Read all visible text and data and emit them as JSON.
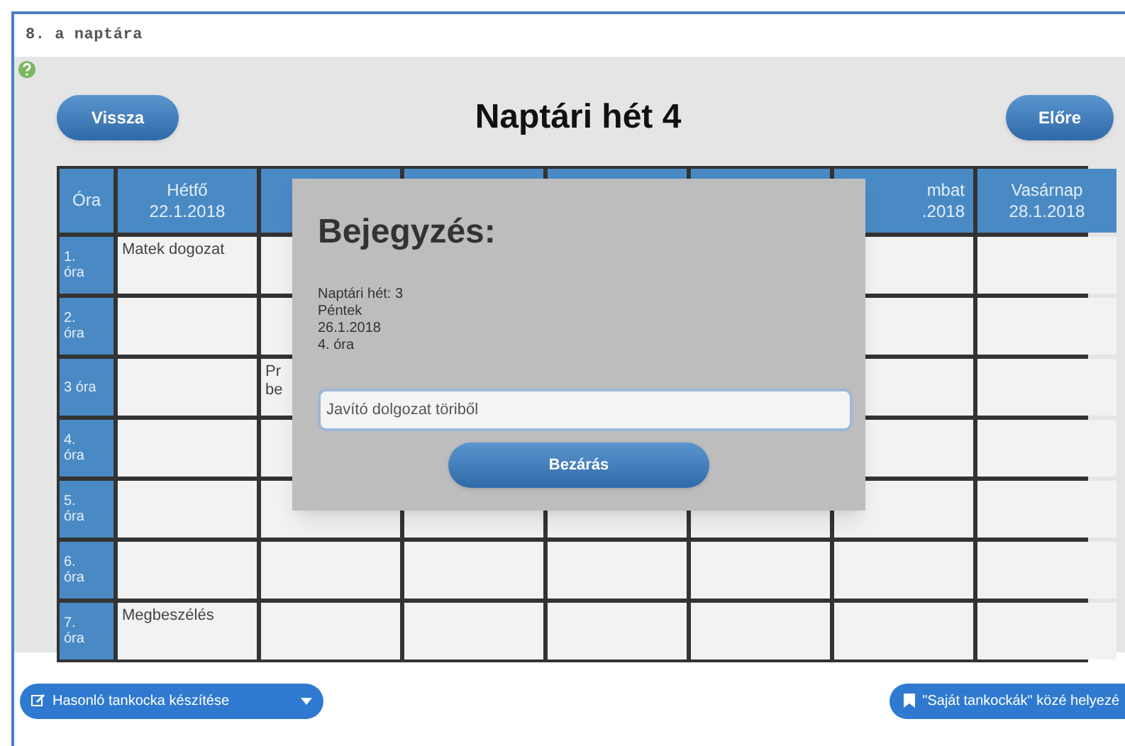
{
  "window": {
    "title": "8. a naptára"
  },
  "nav": {
    "back": "Vissza",
    "title": "Naptári hét 4",
    "forward": "Előre"
  },
  "table": {
    "corner": "Óra",
    "columns": [
      {
        "day": "Hétfő",
        "date": "22.1.2018"
      },
      {},
      {},
      {},
      {},
      {
        "day": "mbat",
        "date": ".2018"
      },
      {
        "day": "Vasárnap",
        "date": "28.1.2018"
      }
    ],
    "rows": [
      {
        "label": "1.\nóra",
        "cells": [
          {
            "text": "Matek dogozat"
          },
          {},
          {},
          {},
          {},
          {},
          {}
        ]
      },
      {
        "label": "2.\nóra",
        "cells": [
          {},
          {},
          {},
          {},
          {},
          {},
          {}
        ]
      },
      {
        "label": "3 óra",
        "cells": [
          {},
          {
            "text": "Pr\nbe"
          },
          {},
          {},
          {},
          {},
          {}
        ]
      },
      {
        "label": "4.\nóra",
        "cells": [
          {},
          {},
          {},
          {},
          {},
          {},
          {}
        ]
      },
      {
        "label": "5.\nóra",
        "cells": [
          {},
          {},
          {},
          {},
          {},
          {},
          {}
        ]
      },
      {
        "label": "6.\nóra",
        "cells": [
          {},
          {},
          {},
          {},
          {},
          {},
          {}
        ]
      },
      {
        "label": "7.\nóra",
        "cells": [
          {
            "text": "Megbeszélés"
          },
          {},
          {},
          {},
          {},
          {},
          {}
        ]
      }
    ]
  },
  "dialog": {
    "title": "Bejegyzés:",
    "details": [
      "Naptári hét: 3",
      "Péntek",
      "26.1.2018",
      "4. óra"
    ],
    "input_value": "Javító dolgozat töriből",
    "close": "Bezárás"
  },
  "footer": {
    "left_button": "Hasonló tankocka készítése",
    "right_button": "\"Saját tankockák\" közé helyezé"
  }
}
